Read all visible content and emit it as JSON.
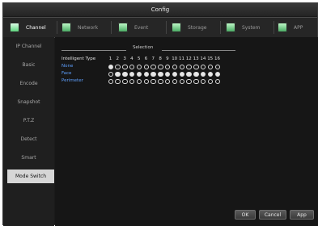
{
  "window": {
    "title": "Config"
  },
  "tabs": [
    {
      "label": "Channel",
      "icon": "channel-icon",
      "active": true
    },
    {
      "label": "Network",
      "icon": "network-icon",
      "active": false
    },
    {
      "label": "Event",
      "icon": "event-icon",
      "active": false
    },
    {
      "label": "Storage",
      "icon": "storage-icon",
      "active": false
    },
    {
      "label": "System",
      "icon": "system-icon",
      "active": false
    },
    {
      "label": "APP",
      "icon": "app-icon",
      "active": false
    }
  ],
  "sidebar": {
    "items": [
      {
        "label": "IP Channel",
        "active": false
      },
      {
        "label": "Basic",
        "active": false
      },
      {
        "label": "Encode",
        "active": false
      },
      {
        "label": "Snapshot",
        "active": false
      },
      {
        "label": "P.T.Z",
        "active": false
      },
      {
        "label": "Detect",
        "active": false
      },
      {
        "label": "Smart",
        "active": false
      },
      {
        "label": "Mode Switch",
        "active": true
      }
    ]
  },
  "selection": {
    "header": "Selection",
    "type_label": "Intelligent Type",
    "channels": [
      "1",
      "2",
      "3",
      "4",
      "5",
      "6",
      "7",
      "8",
      "9",
      "10",
      "11",
      "12",
      "13",
      "14",
      "15",
      "16"
    ],
    "rows": [
      {
        "label": "None",
        "selected": [
          true,
          false,
          false,
          false,
          false,
          false,
          false,
          false,
          false,
          false,
          false,
          false,
          false,
          false,
          false,
          false
        ]
      },
      {
        "label": "Face",
        "selected": [
          false,
          true,
          true,
          true,
          true,
          true,
          true,
          true,
          true,
          true,
          true,
          true,
          true,
          true,
          true,
          true
        ]
      },
      {
        "label": "Perimeter",
        "selected": [
          false,
          false,
          false,
          false,
          false,
          false,
          false,
          false,
          false,
          false,
          false,
          false,
          false,
          false,
          false,
          false
        ]
      }
    ]
  },
  "buttons": {
    "ok": "OK",
    "cancel": "Cancel",
    "apply": "App"
  },
  "colors": {
    "accent_text": "#5ea0ff",
    "tab_icon": "#3ea35a",
    "active_sidebar": "#d6d6d6"
  }
}
